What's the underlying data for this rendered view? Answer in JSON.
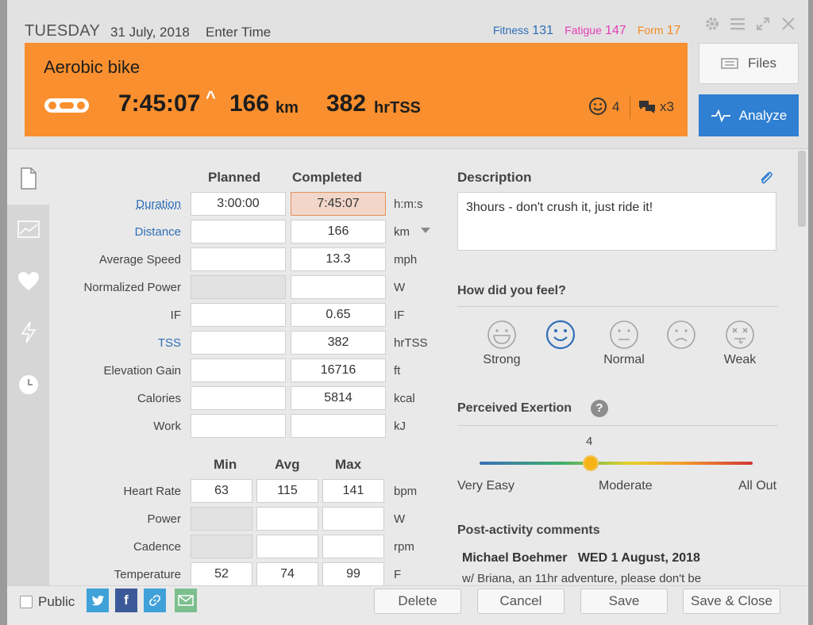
{
  "header": {
    "day": "TUESDAY",
    "date": "31 July, 2018",
    "enter_time": "Enter Time",
    "fitness_label": "Fitness",
    "fitness_value": "131",
    "fatigue_label": "Fatigue",
    "fatigue_value": "147",
    "form_label": "Form",
    "form_value": "17",
    "icons": [
      "gear-icon",
      "menu-icon",
      "expand-icon",
      "close-icon"
    ]
  },
  "banner": {
    "title": "Aerobic bike",
    "duration": "7:45:07",
    "caret": "^",
    "distance": "166",
    "distance_unit": "km",
    "tss": "382",
    "tss_unit": "hrTSS",
    "smile_count": "4",
    "comment_count": "x3",
    "color": "#f98f2e"
  },
  "actions": {
    "files_label": "Files",
    "analyze_label": "Analyze",
    "analyze_color": "#2f7fd2"
  },
  "sidebar": {
    "items": [
      "document-icon",
      "chart-icon",
      "heart-icon",
      "lightning-icon",
      "clock-icon"
    ]
  },
  "summary": {
    "planned_header": "Planned",
    "completed_header": "Completed",
    "rows": [
      {
        "label": "Duration",
        "planned": "3:00:00",
        "completed": "7:45:07",
        "unit": "h:m:s"
      },
      {
        "label": "Distance",
        "planned": "",
        "completed": "166",
        "unit": "km"
      },
      {
        "label": "Average Speed",
        "planned": "",
        "completed": "13.3",
        "unit": "mph"
      },
      {
        "label": "Normalized Power",
        "planned": "",
        "completed": "",
        "unit": "W"
      },
      {
        "label": "IF",
        "planned": "",
        "completed": "0.65",
        "unit": "IF"
      },
      {
        "label": "TSS",
        "planned": "",
        "completed": "382",
        "unit": "hrTSS"
      },
      {
        "label": "Elevation Gain",
        "planned": "",
        "completed": "16716",
        "unit": "ft"
      },
      {
        "label": "Calories",
        "planned": "",
        "completed": "5814",
        "unit": "kcal"
      },
      {
        "label": "Work",
        "planned": "",
        "completed": "",
        "unit": "kJ"
      }
    ]
  },
  "ranges": {
    "min_header": "Min",
    "avg_header": "Avg",
    "max_header": "Max",
    "rows": [
      {
        "label": "Heart Rate",
        "min": "63",
        "avg": "115",
        "max": "141",
        "unit": "bpm"
      },
      {
        "label": "Power",
        "min": "",
        "avg": "",
        "max": "",
        "unit": "W"
      },
      {
        "label": "Cadence",
        "min": "",
        "avg": "",
        "max": "",
        "unit": "rpm"
      },
      {
        "label": "Temperature",
        "min": "52",
        "avg": "74",
        "max": "99",
        "unit": "F"
      }
    ]
  },
  "description": {
    "heading": "Description",
    "text": "3hours - don't crush it, just ride it!"
  },
  "feel": {
    "heading": "How did you feel?",
    "options": [
      "Strong",
      "",
      "Normal",
      "",
      "Weak"
    ],
    "selected_index": 1
  },
  "exertion": {
    "heading": "Perceived Exertion",
    "help": "?",
    "value": "4",
    "min_label": "Very Easy",
    "mid_label": "Moderate",
    "max_label": "All Out"
  },
  "comments": {
    "heading": "Post-activity comments",
    "author": "Michael Boehmer",
    "date": "WED 1 August, 2018",
    "text": "w/ Briana, an 11hr adventure, please don't be"
  },
  "footer": {
    "public_label": "Public",
    "delete_label": "Delete",
    "cancel_label": "Cancel",
    "save_label": "Save",
    "save_close_label": "Save & Close"
  }
}
